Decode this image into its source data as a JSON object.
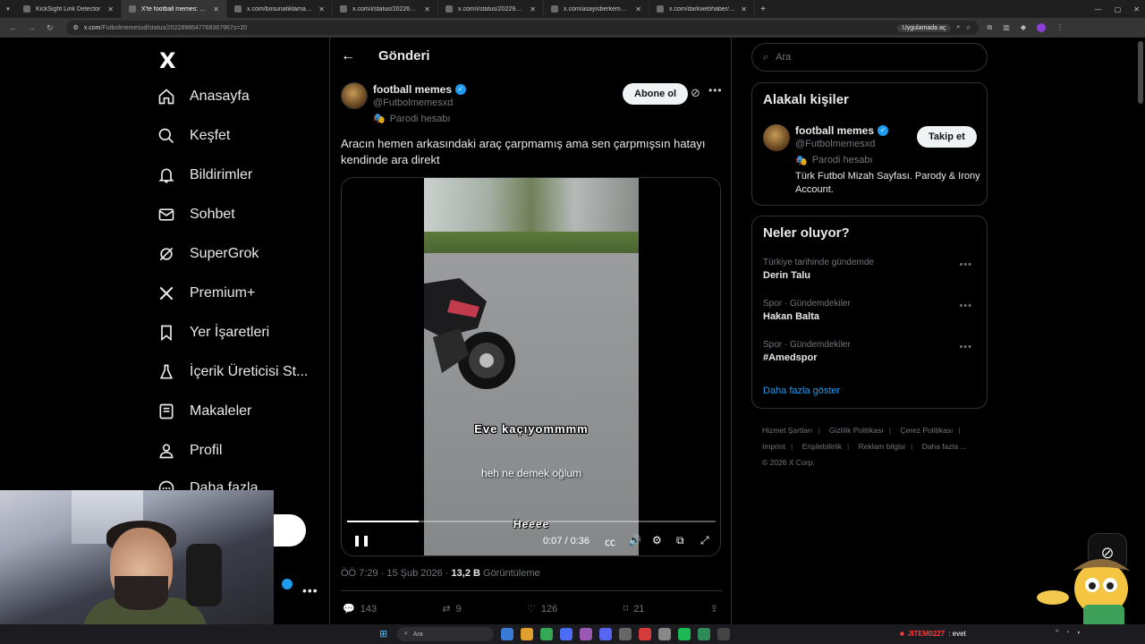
{
  "browser": {
    "tabs": [
      {
        "label": "KickSight Link Detector",
        "active": false
      },
      {
        "label": "X'te football memes: \"Aracın",
        "active": true
      },
      {
        "label": "x.com/bosunatiklama/status/20",
        "active": false
      },
      {
        "label": "x.com/i/status/2022687833857",
        "active": false
      },
      {
        "label": "x.com/i/status/2022975452575",
        "active": false
      },
      {
        "label": "x.com/asayisberkemal0/status/",
        "active": false
      },
      {
        "label": "x.com/darkwebhaber/status/20",
        "active": false
      }
    ],
    "url_host": "x.com",
    "url_path": "/Futbolmemesxd/status/2022898647768367967s=20",
    "app_badge": "Uygulamada aç"
  },
  "nav": {
    "logo": "X",
    "items": [
      {
        "label": "Anasayfa",
        "icon": "home-icon"
      },
      {
        "label": "Keşfet",
        "icon": "search-icon"
      },
      {
        "label": "Bildirimler",
        "icon": "bell-icon"
      },
      {
        "label": "Sohbet",
        "icon": "mail-icon"
      },
      {
        "label": "SuperGrok",
        "icon": "grok-icon"
      },
      {
        "label": "Premium+",
        "icon": "x-premium-icon"
      },
      {
        "label": "Yer İşaretleri",
        "icon": "bookmark-icon"
      },
      {
        "label": "İçerik Üreticisi St...",
        "icon": "creator-studio-icon"
      },
      {
        "label": "Makaleler",
        "icon": "articles-icon"
      },
      {
        "label": "Profil",
        "icon": "profile-icon"
      },
      {
        "label": "Daha fazla",
        "icon": "more-circle-icon"
      }
    ]
  },
  "post": {
    "header_title": "Gönderi",
    "author_name": "football memes",
    "author_handle": "@Futbolmemesxd",
    "parody_label": "Parodi hesabı",
    "follow_label": "Abone ol",
    "text": "Aracın hemen arkasındaki araç çarpmamış ama sen çarpmışsın hatayı kendinde ara direkt",
    "video": {
      "subtitle_1": "Eve kaçıyommmm",
      "subtitle_2": "heh ne demek oğlum",
      "subtitle_3": "Heeee",
      "time": "0:07 / 0:36",
      "progress": 0.195
    },
    "timestamp": "ÖÖ 7:29 · 15 Şub 2026 · ",
    "views": "13,2 B",
    "views_label": " Görüntüleme",
    "stats": {
      "replies": "143",
      "reposts": "9",
      "likes": "126",
      "bookmarks": "21"
    }
  },
  "right": {
    "search_placeholder": "Ara",
    "related_title": "Alakalı kişiler",
    "related": {
      "name": "football memes",
      "handle": "@Futbolmemesxd",
      "parody": "Parodi hesabı",
      "bio": "Türk Futbol Mizah Sayfası. Parody & Irony Account.",
      "follow_label": "Takip et"
    },
    "trends_title": "Neler oluyor?",
    "trends": [
      {
        "context": "Türkiye tarihinde gündemde",
        "name": "Derin Talu"
      },
      {
        "context": "Spor · Gündemdekiler",
        "name": "Hakan Balta"
      },
      {
        "context": "Spor · Gündemdekiler",
        "name": "#Amedspor"
      }
    ],
    "show_more": "Daha fazla göster",
    "footer_links": [
      "Hizmet Şartları",
      "Gizlilik Politikası",
      "Çerez Politikası",
      "Imprint",
      "Erişilebilirlik",
      "Reklam bilgisi",
      "Daha fazla ..."
    ],
    "copyright": "© 2026 X Corp."
  },
  "taskbar": {
    "search_label": "Ara",
    "chat_user": "JITEM0227",
    "chat_message": ": evet"
  },
  "colors": {
    "accent": "#1d9bf0",
    "background": "#000000",
    "border": "#2f3336",
    "muted": "#71767b"
  }
}
